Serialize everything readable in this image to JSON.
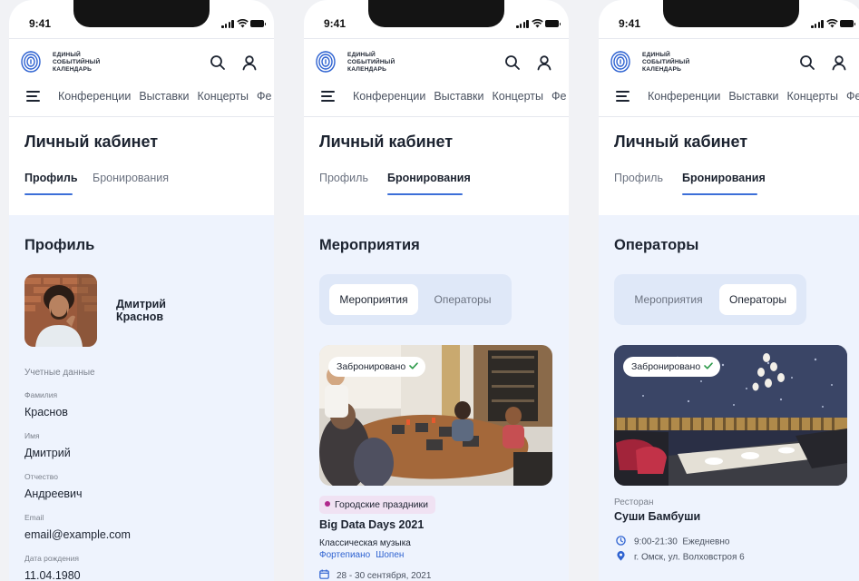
{
  "statusbar": {
    "time": "9:41"
  },
  "logo": {
    "line1": "ЕДИНЫЙ",
    "line2": "СОБЫТИЙНЫЙ",
    "line3": "КАЛЕНДАРЬ"
  },
  "nav": {
    "items": [
      "Конференции",
      "Выставки",
      "Концерты",
      "Фе"
    ]
  },
  "page": {
    "title": "Личный кабинет",
    "tabs": {
      "profile": "Профиль",
      "bookings": "Бронирования"
    }
  },
  "profile": {
    "section_title": "Профиль",
    "first_name": "Дмитрий",
    "last_name": "Краснов",
    "credentials_label": "Учетные данные",
    "fields": [
      {
        "label": "Фамилия",
        "value": "Краснов"
      },
      {
        "label": "Имя",
        "value": "Дмитрий"
      },
      {
        "label": "Отчество",
        "value": "Андреевич"
      },
      {
        "label": "Email",
        "value": "email@example.com"
      },
      {
        "label": "Дата рождения",
        "value": "11.04.1980"
      }
    ]
  },
  "bookings": {
    "segments": {
      "events": "Мероприятия",
      "operators": "Операторы"
    },
    "events_section_title": "Мероприятия",
    "operators_section_title": "Операторы",
    "booked_label": "Забронировано",
    "event": {
      "category": "Городские праздники",
      "title": "Big Data Days 2021",
      "genre": "Классическая музыка",
      "tags": [
        "Фортепиано",
        "Шопен"
      ],
      "date": "28 - 30 сентября, 2021"
    },
    "operator": {
      "type": "Ресторан",
      "name": "Суши Бамбуши",
      "hours": "9:00-21:30",
      "schedule": "Ежедневно",
      "address": "г. Омск, ул. Волховстроя 6"
    }
  },
  "colors": {
    "accent": "#3c6fd8",
    "page_background": "#eef3fd",
    "segmented_background": "#dfe8f8",
    "category_chip": "#f0e2f3",
    "category_dot": "#b0298c",
    "booked_check": "#2e9b4b"
  },
  "icons": [
    "logo-fingerprint-icon",
    "search-icon",
    "user-icon",
    "burger-menu-icon",
    "check-icon",
    "calendar-icon",
    "clock-icon",
    "location-pin-icon"
  ]
}
